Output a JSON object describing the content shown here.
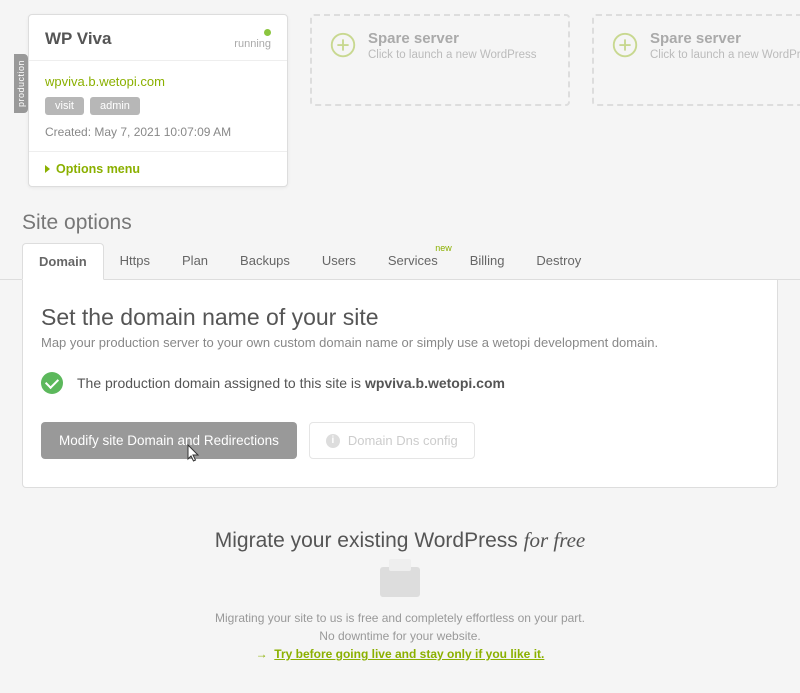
{
  "production": {
    "tab_label": "production",
    "site_title": "WP Viva",
    "status": "running",
    "domain": "wpviva.b.wetopi.com",
    "visit_label": "visit",
    "admin_label": "admin",
    "created_label": "Created: May 7, 2021 10:07:09 AM",
    "options_menu": "Options menu"
  },
  "spares": [
    {
      "title": "Spare server",
      "hint": "Click to launch a new WordPress"
    },
    {
      "title": "Spare server",
      "hint": "Click to launch a new WordPress"
    }
  ],
  "site_options": {
    "heading": "Site options",
    "tabs": [
      "Domain",
      "Https",
      "Plan",
      "Backups",
      "Users",
      "Services",
      "Billing",
      "Destroy"
    ],
    "services_badge": "new"
  },
  "domain_panel": {
    "title": "Set the domain name of your site",
    "subtitle": "Map your production server to your own custom domain name or simply use a wetopi development domain.",
    "assigned_prefix": "The production domain assigned to this site is ",
    "assigned_domain": "wpviva.b.wetopi.com",
    "modify_btn": "Modify site Domain and Redirections",
    "dns_btn": "Domain Dns config"
  },
  "migrate": {
    "heading_a": "Migrate your existing WordPress ",
    "heading_b": "for free",
    "line1": "Migrating your site to us is free and completely effortless on your part.",
    "line2": "No downtime for your website.",
    "cta": "Try before going live and stay only if you like it."
  }
}
